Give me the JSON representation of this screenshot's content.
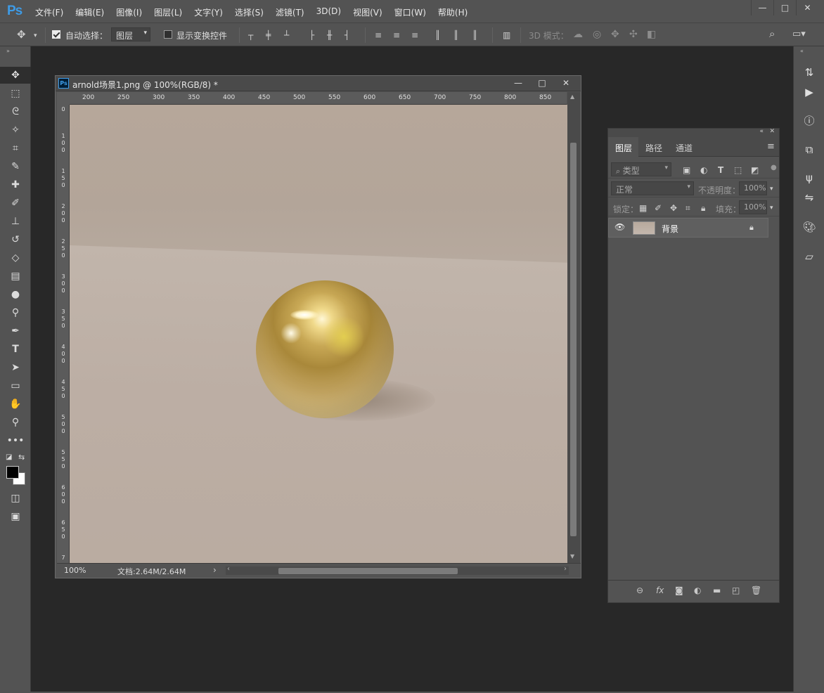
{
  "app": {
    "logo": "Ps"
  },
  "menu": [
    "文件(F)",
    "编辑(E)",
    "图像(I)",
    "图层(L)",
    "文字(Y)",
    "选择(S)",
    "滤镜(T)",
    "3D(D)",
    "视图(V)",
    "窗口(W)",
    "帮助(H)"
  ],
  "window_controls": {
    "minimize": "—",
    "restore": "□",
    "close": "✕"
  },
  "options": {
    "auto_select_label": "自动选择：",
    "auto_select_checked": true,
    "auto_select_value": "图层",
    "show_transform_label": "显示变换控件",
    "show_transform_checked": false,
    "mode_3d_label": "3D 模式："
  },
  "document": {
    "title": "arnold场景1.png @ 100%(RGB/8) *",
    "zoom": "100%",
    "doc_size": "文档:2.64M/2.64M",
    "ruler_h": [
      "200",
      "250",
      "300",
      "350",
      "400",
      "450",
      "500",
      "550",
      "600",
      "650",
      "700",
      "750",
      "800",
      "850"
    ],
    "ruler_v": [
      "0",
      "1\n0\n0",
      "1\n5\n0",
      "2\n0\n0",
      "2\n5\n0",
      "3\n0\n0",
      "3\n5\n0",
      "4\n0\n0",
      "4\n5\n0",
      "5\n0\n0",
      "5\n5\n0",
      "6\n0\n0",
      "6\n5\n0",
      "7"
    ]
  },
  "layers_panel": {
    "tabs": [
      "图层",
      "路径",
      "通道"
    ],
    "active_tab": "图层",
    "filter_placeholder": "类型",
    "blend_mode": "正常",
    "opacity_label": "不透明度：",
    "opacity_value": "100%",
    "lock_label": "锁定：",
    "fill_label": "填充：",
    "fill_value": "100%",
    "layers": [
      {
        "name": "背景",
        "visible": true,
        "locked": true
      }
    ]
  },
  "colors": {
    "ui_bg": "#535353",
    "workspace_bg": "#282828",
    "accent": "#3e9be6"
  }
}
